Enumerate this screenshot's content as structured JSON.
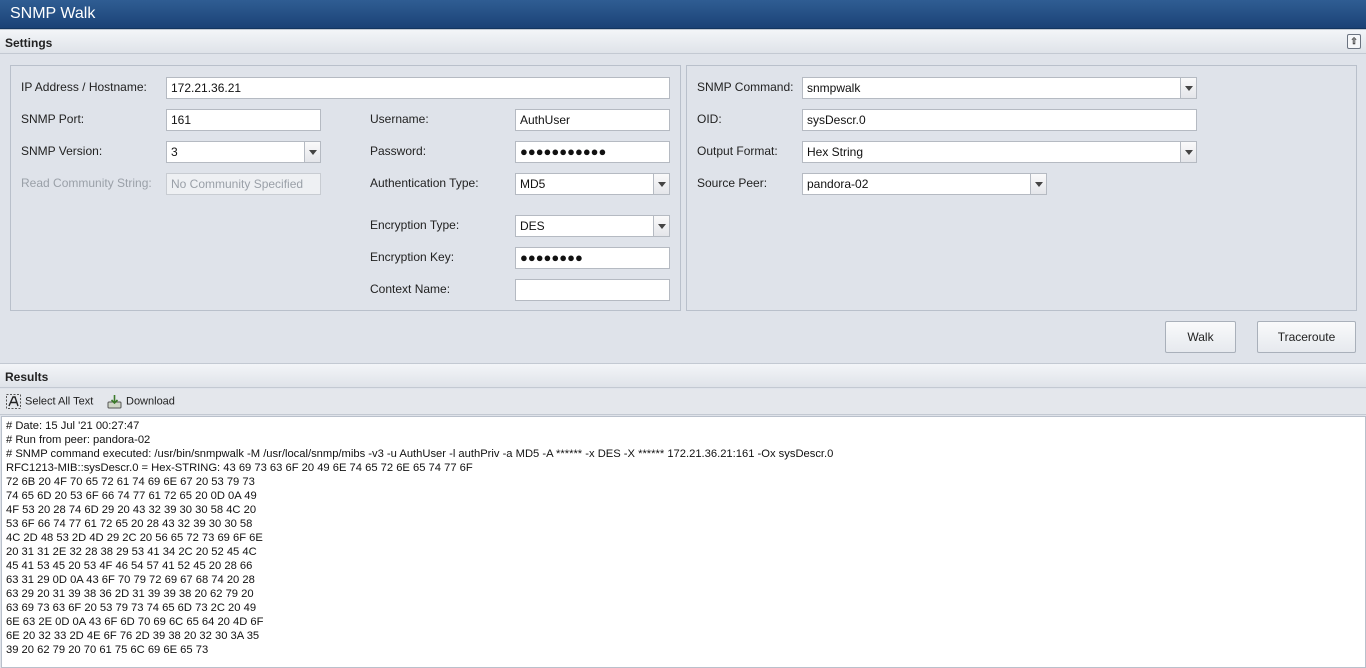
{
  "window": {
    "title": "SNMP Walk"
  },
  "settings": {
    "header": "Settings",
    "left": {
      "ip_label": "IP Address / Hostname:",
      "ip_value": "172.21.36.21",
      "port_label": "SNMP Port:",
      "port_value": "161",
      "version_label": "SNMP Version:",
      "version_value": "3",
      "community_label": "Read Community String:",
      "community_placeholder": "No Community Specified",
      "username_label": "Username:",
      "username_value": "AuthUser",
      "password_label": "Password:",
      "password_value": "●●●●●●●●●●●",
      "auth_type_label": "Authentication Type:",
      "auth_type_value": "MD5",
      "enc_type_label": "Encryption Type:",
      "enc_type_value": "DES",
      "enc_key_label": "Encryption Key:",
      "enc_key_value": "●●●●●●●●",
      "context_label": "Context Name:",
      "context_value": ""
    },
    "right": {
      "command_label": "SNMP Command:",
      "command_value": "snmpwalk",
      "oid_label": "OID:",
      "oid_value": "sysDescr.0",
      "format_label": "Output Format:",
      "format_value": "Hex String",
      "peer_label": "Source Peer:",
      "peer_value": "pandora-02"
    },
    "buttons": {
      "walk": "Walk",
      "traceroute": "Traceroute"
    }
  },
  "results": {
    "header": "Results",
    "toolbar": {
      "select_all": "Select All Text",
      "download": "Download"
    },
    "lines": [
      "# Date: 15 Jul '21 00:27:47",
      "# Run from peer: pandora-02",
      "# SNMP command executed: /usr/bin/snmpwalk -M /usr/local/snmp/mibs -v3 -u AuthUser -l authPriv -a MD5 -A ****** -x DES -X ****** 172.21.36.21:161 -Ox sysDescr.0",
      "RFC1213-MIB::sysDescr.0 = Hex-STRING: 43 69 73 63 6F 20 49 6E 74 65 72 6E 65 74 77 6F",
      "72 6B 20 4F 70 65 72 61 74 69 6E 67 20 53 79 73",
      "74 65 6D 20 53 6F 66 74 77 61 72 65 20 0D 0A 49",
      "4F 53 20 28 74 6D 29 20 43 32 39 30 30 58 4C 20",
      "53 6F 66 74 77 61 72 65 20 28 43 32 39 30 30 58",
      "4C 2D 48 53 2D 4D 29 2C 20 56 65 72 73 69 6F 6E",
      "20 31 31 2E 32 28 38 29 53 41 34 2C 20 52 45 4C",
      "45 41 53 45 20 53 4F 46 54 57 41 52 45 20 28 66",
      "63 31 29 0D 0A 43 6F 70 79 72 69 67 68 74 20 28",
      "63 29 20 31 39 38 36 2D 31 39 39 38 20 62 79 20",
      "63 69 73 63 6F 20 53 79 73 74 65 6D 73 2C 20 49",
      "6E 63 2E 0D 0A 43 6F 6D 70 69 6C 65 64 20 4D 6F",
      "6E 20 32 33 2D 4E 6F 76 2D 39 38 20 32 30 3A 35",
      "39 20 62 79 20 70 61 75 6C 69 6E 65 73"
    ]
  }
}
